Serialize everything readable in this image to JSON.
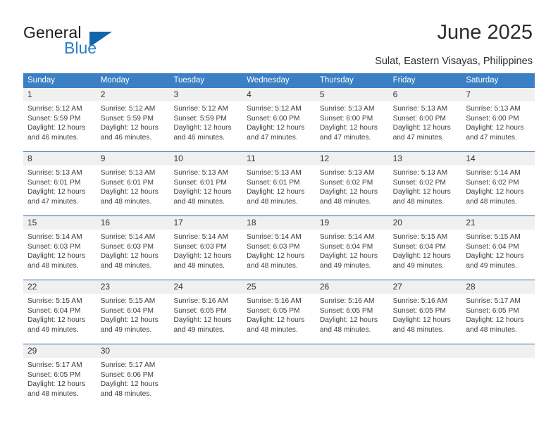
{
  "brand": {
    "name_part1": "General",
    "name_part2": "Blue",
    "logo_icon": "triangle-logo-icon",
    "accent_color": "#1165a8",
    "secondary_color": "#2b7cc4"
  },
  "header": {
    "title": "June 2025",
    "location": "Sulat, Eastern Visayas, Philippines"
  },
  "calendar": {
    "header_bg": "#3b7fc4",
    "row_separator": "#2f6ca8",
    "daynum_bg": "#f0f0f0",
    "weekdays": [
      "Sunday",
      "Monday",
      "Tuesday",
      "Wednesday",
      "Thursday",
      "Friday",
      "Saturday"
    ],
    "weeks": [
      [
        {
          "day": "1",
          "sunrise": "Sunrise: 5:12 AM",
          "sunset": "Sunset: 5:59 PM",
          "daylight_1": "Daylight: 12 hours",
          "daylight_2": "and 46 minutes."
        },
        {
          "day": "2",
          "sunrise": "Sunrise: 5:12 AM",
          "sunset": "Sunset: 5:59 PM",
          "daylight_1": "Daylight: 12 hours",
          "daylight_2": "and 46 minutes."
        },
        {
          "day": "3",
          "sunrise": "Sunrise: 5:12 AM",
          "sunset": "Sunset: 5:59 PM",
          "daylight_1": "Daylight: 12 hours",
          "daylight_2": "and 46 minutes."
        },
        {
          "day": "4",
          "sunrise": "Sunrise: 5:12 AM",
          "sunset": "Sunset: 6:00 PM",
          "daylight_1": "Daylight: 12 hours",
          "daylight_2": "and 47 minutes."
        },
        {
          "day": "5",
          "sunrise": "Sunrise: 5:13 AM",
          "sunset": "Sunset: 6:00 PM",
          "daylight_1": "Daylight: 12 hours",
          "daylight_2": "and 47 minutes."
        },
        {
          "day": "6",
          "sunrise": "Sunrise: 5:13 AM",
          "sunset": "Sunset: 6:00 PM",
          "daylight_1": "Daylight: 12 hours",
          "daylight_2": "and 47 minutes."
        },
        {
          "day": "7",
          "sunrise": "Sunrise: 5:13 AM",
          "sunset": "Sunset: 6:00 PM",
          "daylight_1": "Daylight: 12 hours",
          "daylight_2": "and 47 minutes."
        }
      ],
      [
        {
          "day": "8",
          "sunrise": "Sunrise: 5:13 AM",
          "sunset": "Sunset: 6:01 PM",
          "daylight_1": "Daylight: 12 hours",
          "daylight_2": "and 47 minutes."
        },
        {
          "day": "9",
          "sunrise": "Sunrise: 5:13 AM",
          "sunset": "Sunset: 6:01 PM",
          "daylight_1": "Daylight: 12 hours",
          "daylight_2": "and 48 minutes."
        },
        {
          "day": "10",
          "sunrise": "Sunrise: 5:13 AM",
          "sunset": "Sunset: 6:01 PM",
          "daylight_1": "Daylight: 12 hours",
          "daylight_2": "and 48 minutes."
        },
        {
          "day": "11",
          "sunrise": "Sunrise: 5:13 AM",
          "sunset": "Sunset: 6:01 PM",
          "daylight_1": "Daylight: 12 hours",
          "daylight_2": "and 48 minutes."
        },
        {
          "day": "12",
          "sunrise": "Sunrise: 5:13 AM",
          "sunset": "Sunset: 6:02 PM",
          "daylight_1": "Daylight: 12 hours",
          "daylight_2": "and 48 minutes."
        },
        {
          "day": "13",
          "sunrise": "Sunrise: 5:13 AM",
          "sunset": "Sunset: 6:02 PM",
          "daylight_1": "Daylight: 12 hours",
          "daylight_2": "and 48 minutes."
        },
        {
          "day": "14",
          "sunrise": "Sunrise: 5:14 AM",
          "sunset": "Sunset: 6:02 PM",
          "daylight_1": "Daylight: 12 hours",
          "daylight_2": "and 48 minutes."
        }
      ],
      [
        {
          "day": "15",
          "sunrise": "Sunrise: 5:14 AM",
          "sunset": "Sunset: 6:03 PM",
          "daylight_1": "Daylight: 12 hours",
          "daylight_2": "and 48 minutes."
        },
        {
          "day": "16",
          "sunrise": "Sunrise: 5:14 AM",
          "sunset": "Sunset: 6:03 PM",
          "daylight_1": "Daylight: 12 hours",
          "daylight_2": "and 48 minutes."
        },
        {
          "day": "17",
          "sunrise": "Sunrise: 5:14 AM",
          "sunset": "Sunset: 6:03 PM",
          "daylight_1": "Daylight: 12 hours",
          "daylight_2": "and 48 minutes."
        },
        {
          "day": "18",
          "sunrise": "Sunrise: 5:14 AM",
          "sunset": "Sunset: 6:03 PM",
          "daylight_1": "Daylight: 12 hours",
          "daylight_2": "and 48 minutes."
        },
        {
          "day": "19",
          "sunrise": "Sunrise: 5:14 AM",
          "sunset": "Sunset: 6:04 PM",
          "daylight_1": "Daylight: 12 hours",
          "daylight_2": "and 49 minutes."
        },
        {
          "day": "20",
          "sunrise": "Sunrise: 5:15 AM",
          "sunset": "Sunset: 6:04 PM",
          "daylight_1": "Daylight: 12 hours",
          "daylight_2": "and 49 minutes."
        },
        {
          "day": "21",
          "sunrise": "Sunrise: 5:15 AM",
          "sunset": "Sunset: 6:04 PM",
          "daylight_1": "Daylight: 12 hours",
          "daylight_2": "and 49 minutes."
        }
      ],
      [
        {
          "day": "22",
          "sunrise": "Sunrise: 5:15 AM",
          "sunset": "Sunset: 6:04 PM",
          "daylight_1": "Daylight: 12 hours",
          "daylight_2": "and 49 minutes."
        },
        {
          "day": "23",
          "sunrise": "Sunrise: 5:15 AM",
          "sunset": "Sunset: 6:04 PM",
          "daylight_1": "Daylight: 12 hours",
          "daylight_2": "and 49 minutes."
        },
        {
          "day": "24",
          "sunrise": "Sunrise: 5:16 AM",
          "sunset": "Sunset: 6:05 PM",
          "daylight_1": "Daylight: 12 hours",
          "daylight_2": "and 49 minutes."
        },
        {
          "day": "25",
          "sunrise": "Sunrise: 5:16 AM",
          "sunset": "Sunset: 6:05 PM",
          "daylight_1": "Daylight: 12 hours",
          "daylight_2": "and 48 minutes."
        },
        {
          "day": "26",
          "sunrise": "Sunrise: 5:16 AM",
          "sunset": "Sunset: 6:05 PM",
          "daylight_1": "Daylight: 12 hours",
          "daylight_2": "and 48 minutes."
        },
        {
          "day": "27",
          "sunrise": "Sunrise: 5:16 AM",
          "sunset": "Sunset: 6:05 PM",
          "daylight_1": "Daylight: 12 hours",
          "daylight_2": "and 48 minutes."
        },
        {
          "day": "28",
          "sunrise": "Sunrise: 5:17 AM",
          "sunset": "Sunset: 6:05 PM",
          "daylight_1": "Daylight: 12 hours",
          "daylight_2": "and 48 minutes."
        }
      ],
      [
        {
          "day": "29",
          "sunrise": "Sunrise: 5:17 AM",
          "sunset": "Sunset: 6:05 PM",
          "daylight_1": "Daylight: 12 hours",
          "daylight_2": "and 48 minutes."
        },
        {
          "day": "30",
          "sunrise": "Sunrise: 5:17 AM",
          "sunset": "Sunset: 6:06 PM",
          "daylight_1": "Daylight: 12 hours",
          "daylight_2": "and 48 minutes."
        },
        {
          "day": "",
          "sunrise": "",
          "sunset": "",
          "daylight_1": "",
          "daylight_2": ""
        },
        {
          "day": "",
          "sunrise": "",
          "sunset": "",
          "daylight_1": "",
          "daylight_2": ""
        },
        {
          "day": "",
          "sunrise": "",
          "sunset": "",
          "daylight_1": "",
          "daylight_2": ""
        },
        {
          "day": "",
          "sunrise": "",
          "sunset": "",
          "daylight_1": "",
          "daylight_2": ""
        },
        {
          "day": "",
          "sunrise": "",
          "sunset": "",
          "daylight_1": "",
          "daylight_2": ""
        }
      ]
    ]
  }
}
